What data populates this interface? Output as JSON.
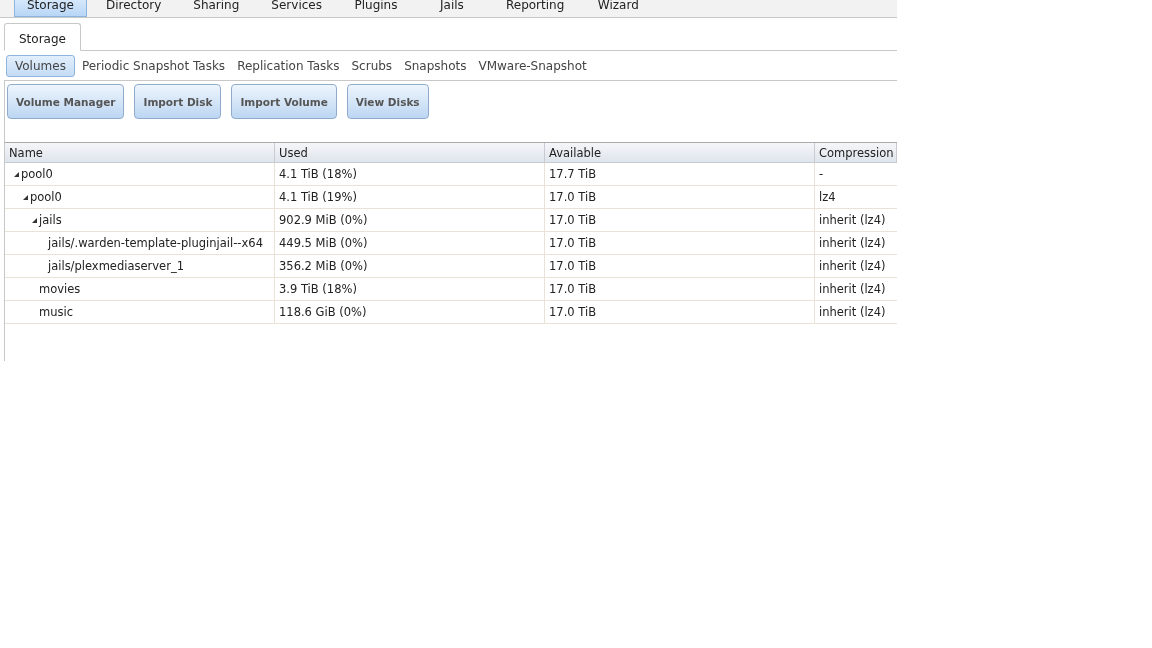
{
  "top_menu": [
    {
      "label": "Storage",
      "selected": true
    },
    {
      "label": "Directory",
      "selected": false
    },
    {
      "label": "Sharing",
      "selected": false
    },
    {
      "label": "Services",
      "selected": false
    },
    {
      "label": "Plugins",
      "selected": false
    },
    {
      "label": "Jails",
      "selected": false
    },
    {
      "label": "Reporting",
      "selected": false
    },
    {
      "label": "Wizard",
      "selected": false
    }
  ],
  "page_tabs": [
    {
      "label": "Storage",
      "selected": true
    }
  ],
  "sub_tabs": [
    {
      "label": "Volumes",
      "selected": true
    },
    {
      "label": "Periodic Snapshot Tasks",
      "selected": false
    },
    {
      "label": "Replication Tasks",
      "selected": false
    },
    {
      "label": "Scrubs",
      "selected": false
    },
    {
      "label": "Snapshots",
      "selected": false
    },
    {
      "label": "VMware-Snapshot",
      "selected": false
    }
  ],
  "buttons": [
    "Volume Manager",
    "Import Disk",
    "Import Volume",
    "View Disks"
  ],
  "table": {
    "columns": [
      "Name",
      "Used",
      "Available",
      "Compression"
    ],
    "rows": [
      {
        "name": "pool0",
        "used": "4.1 TiB (18%)",
        "available": "17.7 TiB",
        "compression": "-",
        "expanded": true,
        "children": [
          {
            "name": "pool0",
            "used": "4.1 TiB (19%)",
            "available": "17.0 TiB",
            "compression": "lz4",
            "expanded": true,
            "children": [
              {
                "name": "jails",
                "used": "902.9 MiB (0%)",
                "available": "17.0 TiB",
                "compression": "inherit (lz4)",
                "expanded": true,
                "children": [
                  {
                    "name": "jails/.warden-template-pluginjail--x64",
                    "used": "449.5 MiB (0%)",
                    "available": "17.0 TiB",
                    "compression": "inherit (lz4)"
                  },
                  {
                    "name": "jails/plexmediaserver_1",
                    "used": "356.2 MiB (0%)",
                    "available": "17.0 TiB",
                    "compression": "inherit (lz4)"
                  }
                ]
              },
              {
                "name": "movies",
                "used": "3.9 TiB (18%)",
                "available": "17.0 TiB",
                "compression": "inherit (lz4)"
              },
              {
                "name": "music",
                "used": "118.6 GiB (0%)",
                "available": "17.0 TiB",
                "compression": "inherit (lz4)"
              }
            ]
          }
        ]
      }
    ]
  }
}
